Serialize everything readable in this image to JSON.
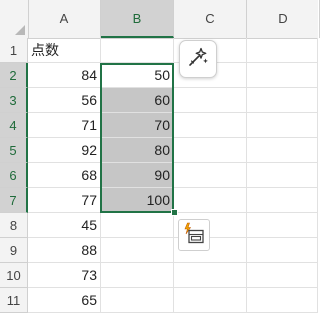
{
  "columns": [
    "A",
    "B",
    "C",
    "D"
  ],
  "rows": [
    "1",
    "2",
    "3",
    "4",
    "5",
    "6",
    "7",
    "8",
    "9",
    "10",
    "11"
  ],
  "cells": {
    "A": [
      "点数",
      "84",
      "56",
      "71",
      "92",
      "68",
      "77",
      "45",
      "88",
      "73",
      "65"
    ],
    "B": [
      "",
      "50",
      "60",
      "70",
      "80",
      "90",
      "100",
      "",
      "",
      "",
      ""
    ]
  },
  "selection": {
    "range": "B2:B7",
    "accent_color": "#217346",
    "highlight_color": "#c6c6c6"
  },
  "icons": {
    "ai_button": "sparkle-wand-icon",
    "quick_analysis": "quick-analysis-icon"
  }
}
